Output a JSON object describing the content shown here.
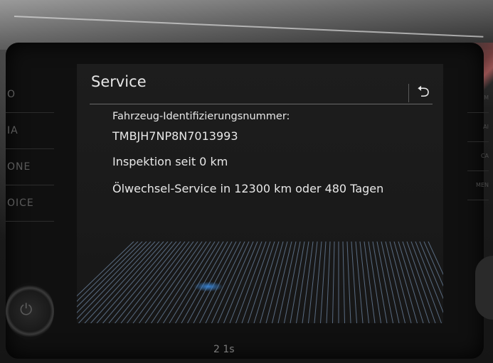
{
  "screen": {
    "title": "Service",
    "back_icon": "back-arrow-icon",
    "lines": {
      "vin_label": "Fahrzeug-Identifizierungsnummer:",
      "vin_value": "TMBJH7NP8N7013993",
      "inspection": "Inspektion seit 0 km",
      "oil_service": "Ölwechsel-Service in 12300 km oder 480 Tagen"
    }
  },
  "left_buttons": [
    "O",
    "IA",
    "ONE",
    "OICE"
  ],
  "right_buttons": [
    "M",
    "AI",
    "CA",
    "MEN"
  ],
  "bottom_status": {
    "temperature": "2 1s"
  },
  "colors": {
    "screen_bg": "#1a1a1a",
    "text": "#e8e8e8",
    "grid": "#8fb0d8",
    "glow": "#3a86d8"
  }
}
